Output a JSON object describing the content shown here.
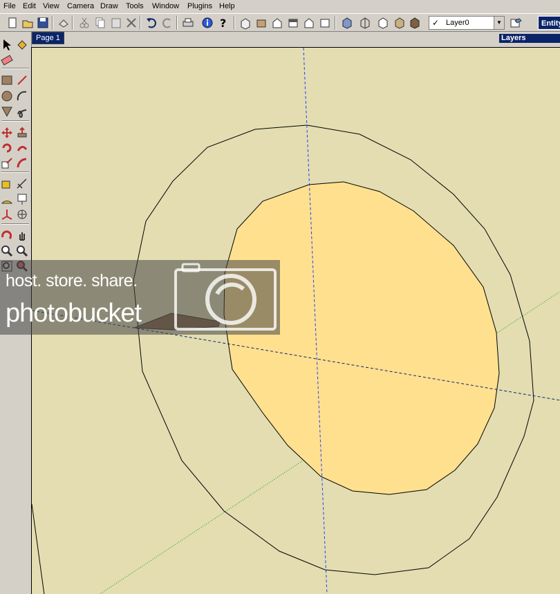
{
  "menu": [
    "File",
    "Edit",
    "View",
    "Camera",
    "Draw",
    "Tools",
    "Window",
    "Plugins",
    "Help"
  ],
  "toolbar": {
    "buttons": [
      "new-icon",
      "open-icon",
      "save-icon",
      "make-component-icon",
      "cut-icon",
      "copy-icon",
      "paste-icon",
      "erase-icon",
      "undo-icon",
      "redo-icon",
      "print-icon",
      "model-info-icon",
      "help-icon",
      "iso-view-icon",
      "top-view-icon",
      "front-view-icon",
      "right-view-icon",
      "back-view-icon",
      "left-view-icon",
      "xray-icon",
      "wireframe-icon",
      "hidden-line-icon",
      "shaded-icon",
      "shaded-texture-icon"
    ],
    "layer_value": "Layer0",
    "layer_check": "✓",
    "entity_tab": "Entity"
  },
  "page_tab": "Page 1",
  "layers_title": "Layers",
  "left_tools": [
    "select-icon",
    "paint-bucket-icon",
    "eraser-icon",
    "rectangle-icon",
    "line-icon",
    "circle-icon",
    "arc-icon",
    "polygon-icon",
    "freehand-icon",
    "move-icon",
    "push-pull-icon",
    "rotate-icon",
    "follow-me-icon",
    "scale-icon",
    "offset-icon",
    "tape-measure-icon",
    "dimension-icon",
    "protractor-icon",
    "text-icon",
    "axes-icon",
    "3d-text-icon",
    "orbit-icon",
    "pan-icon",
    "zoom-icon",
    "zoom-window-icon",
    "zoom-extents-icon",
    "previous-icon"
  ],
  "watermark": {
    "line1": "host. store. share.",
    "line2": "photobucket"
  },
  "colors": {
    "viewport_bg": "#e3ddb1",
    "face_fill": "#ffe08f",
    "axis_blue": "#2040ff",
    "axis_green": "#10a010",
    "title_blue": "#0a246a"
  }
}
